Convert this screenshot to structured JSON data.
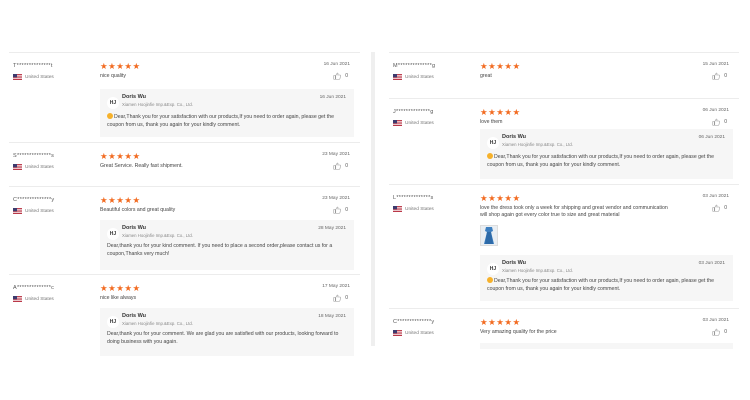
{
  "left_reviews": [
    {
      "reviewer": "T**************t",
      "country": "United States",
      "rating": "★★★★★",
      "date": "16 Jun 2021",
      "text": "nice quality",
      "helpful_count": "0",
      "reply": {
        "avatar": "HJ",
        "name": "Doris Wu",
        "company": "Xiamen Hoojinfie Imp.&Exp. Co., Ltd.",
        "date": "16 Jun 2021",
        "text": "Dear,Thank you for your satisfaction with our products,If you need to order again, please get the coupon from us, thank you again for your kindly comment."
      }
    },
    {
      "reviewer": "S**************s",
      "country": "United States",
      "rating": "★★★★★",
      "date": "23 May 2021",
      "text": "Great Service. Really fast shipment.",
      "helpful_count": "0"
    },
    {
      "reviewer": "C**************y",
      "country": "United States",
      "rating": "★★★★★",
      "date": "23 May 2021",
      "text": "Beautiful colors and great quality",
      "helpful_count": "0",
      "reply": {
        "avatar": "HJ",
        "name": "Doris Wu",
        "company": "Xiamen Hoojinfie Imp.&Exp. Co., Ltd.",
        "date": "28 May 2021",
        "text": "Dear,thank you for your kind comment. If you need to place a second order,please contact us for a coupon,Thanks very much!"
      }
    },
    {
      "reviewer": "A**************c",
      "country": "United States",
      "rating": "★★★★★",
      "date": "17 May 2021",
      "text": "nice like always",
      "helpful_count": "0",
      "reply": {
        "avatar": "HJ",
        "name": "Doris Wu",
        "company": "Xiamen Hoojinfie Imp.&Exp. Co., Ltd.",
        "date": "18 May 2021",
        "text": "Dear,thank you for your comment. We are glad you are satisfied with our products, looking forward to doing business with you again."
      }
    }
  ],
  "right_reviews": [
    {
      "reviewer": "M**************g",
      "country": "United States",
      "rating": "★★★★★",
      "date": "15 Jun 2021",
      "text": "great",
      "helpful_count": "0"
    },
    {
      "reviewer": "J**************g",
      "country": "United States",
      "rating": "★★★★★",
      "date": "06 Jun 2021",
      "text": "love them",
      "helpful_count": "0",
      "reply": {
        "avatar": "HJ",
        "name": "Doris Wu",
        "company": "Xiamen Hoojinfie Imp.&Exp. Co., Ltd.",
        "date": "06 Jun 2021",
        "text": "Dear,Thank you for your satisfaction with our products,If you need to order again, please get the coupon from us, thank you again for your kindly comment."
      }
    },
    {
      "reviewer": "L**************s",
      "country": "United States",
      "rating": "★★★★★",
      "date": "03 Jun 2021",
      "text": "love the dress took only a week for shipping and great vendor and communication will shop again got every color true to size and great material",
      "helpful_count": "0",
      "reply": {
        "avatar": "HJ",
        "name": "Doris Wu",
        "company": "Xiamen Hoojinfie Imp.&Exp. Co., Ltd.",
        "date": "03 Jun 2021",
        "text": "Dear,Thank you for your satisfaction with our products,If you need to order again, please get the coupon from us, thank you again for your kindly comment."
      }
    },
    {
      "reviewer": "C**************y",
      "country": "United States",
      "rating": "★★★★★",
      "date": "03 Jun 2021",
      "text": "Very amazing quality for the price",
      "helpful_count": "0"
    }
  ],
  "icons": {
    "flag": "us-flag-icon",
    "thumb": "thumbs-up-icon",
    "emoji": "smiley-emoji-icon"
  },
  "colors": {
    "star": "#f26b21",
    "reply_bg": "#f6f6f6"
  }
}
